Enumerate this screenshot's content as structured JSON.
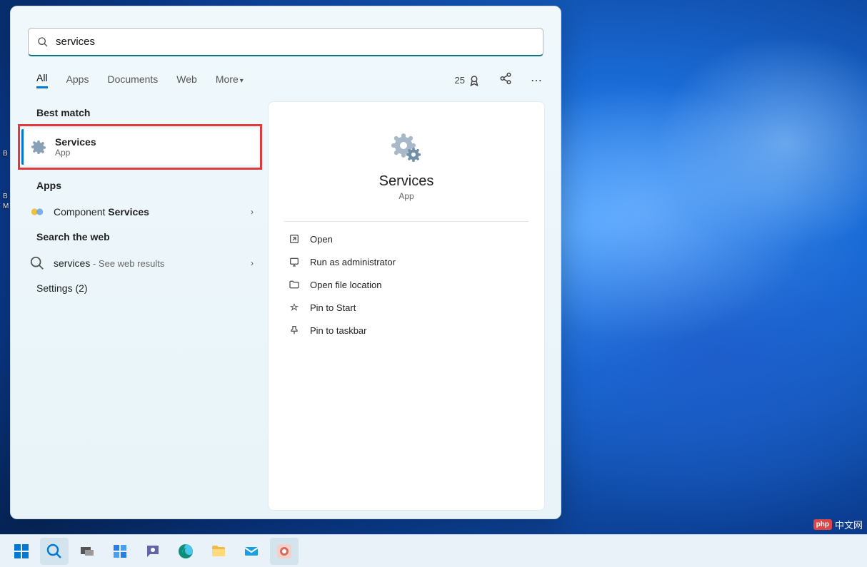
{
  "search": {
    "value": "services"
  },
  "tabs": {
    "all": "All",
    "apps": "Apps",
    "documents": "Documents",
    "web": "Web",
    "more": "More"
  },
  "reward": {
    "points": "25"
  },
  "sections": {
    "best_match": "Best match",
    "apps": "Apps",
    "search_web": "Search the web",
    "settings": "Settings (2)"
  },
  "best_match_item": {
    "title": "Services",
    "sub": "App"
  },
  "apps_item": {
    "prefix": "Component ",
    "bold": "Services"
  },
  "web_item": {
    "term": "services",
    "suffix": " - See web results"
  },
  "preview": {
    "title": "Services",
    "sub": "App"
  },
  "actions": {
    "open": "Open",
    "run_admin": "Run as administrator",
    "open_loc": "Open file location",
    "pin_start": "Pin to Start",
    "pin_taskbar": "Pin to taskbar"
  },
  "watermark": {
    "badge": "php",
    "text": "中文网"
  },
  "desktop_icons": {
    "a": "B",
    "b": "B",
    "c": "M"
  }
}
